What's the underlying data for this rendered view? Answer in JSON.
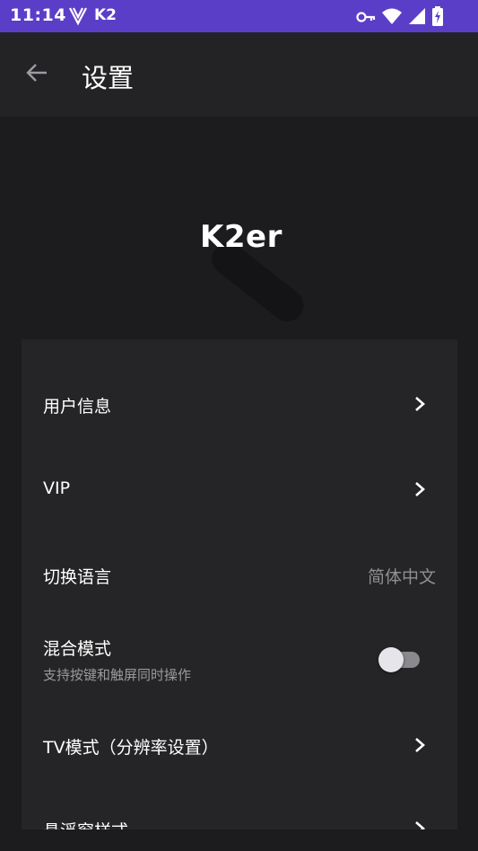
{
  "status_bar": {
    "time": "11:14",
    "carrier": "K2",
    "icons": [
      "key-icon",
      "wifi-icon",
      "signal-icon",
      "battery-charging-icon"
    ]
  },
  "app_bar": {
    "title": "设置",
    "back_icon": "arrow-left-icon"
  },
  "logo": {
    "text": "K2er"
  },
  "settings": {
    "user_info": {
      "label": "用户信息"
    },
    "vip": {
      "label": "VIP"
    },
    "language": {
      "label": "切换语言",
      "value": "简体中文"
    },
    "mixed_mode": {
      "label": "混合模式",
      "description": "支持按键和触屏同时操作",
      "enabled": false
    },
    "tv_mode": {
      "label": "TV模式（分辨率设置）"
    },
    "float_window": {
      "label": "悬浮窗样式"
    }
  },
  "colors": {
    "status_bar": "#5b3ec8",
    "app_bar": "#232326",
    "background": "#1c1c1e",
    "card": "#252527"
  }
}
